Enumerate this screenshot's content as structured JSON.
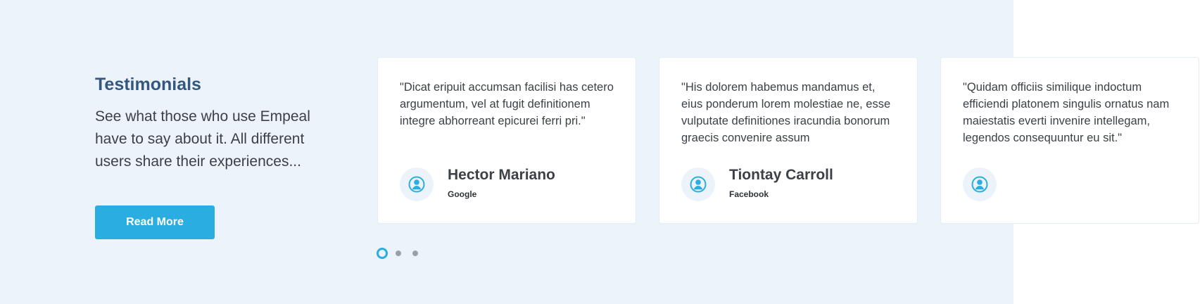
{
  "section": {
    "title": "Testimonials",
    "description": "See what those who use Empeal have to say about it. All different users share their experiences...",
    "button_label": "Read More"
  },
  "testimonials": [
    {
      "quote": "\"Dicat eripuit accumsan facilisi has cetero argumentum, vel at fugit definitionem integre abhorreant epicurei ferri pri.\"",
      "name": "Hector Mariano",
      "company": "Google",
      "avatar_icon": "user-icon"
    },
    {
      "quote": "\"His dolorem habemus mandamus et, eius ponderum lorem molestiae ne, esse vulputate definitiones iracundia bonorum graecis convenire assum",
      "name": "Tiontay Carroll",
      "company": "Facebook",
      "avatar_icon": "user-icon"
    },
    {
      "quote": "\"Quidam officiis similique indoctum efficiendi platonem singulis ornatus nam maiestatis everti invenire intellegam, legendos consequuntur eu sit.\"",
      "name": "",
      "company": "",
      "avatar_icon": "user-icon"
    }
  ],
  "pagination": {
    "active_page": 1,
    "page_count": 3
  },
  "colors": {
    "section_background": "#edf3fb",
    "title": "#34577f",
    "accent": "#2aaee2",
    "text": "#3c4047",
    "inactive_dot": "#9aa1a8"
  }
}
